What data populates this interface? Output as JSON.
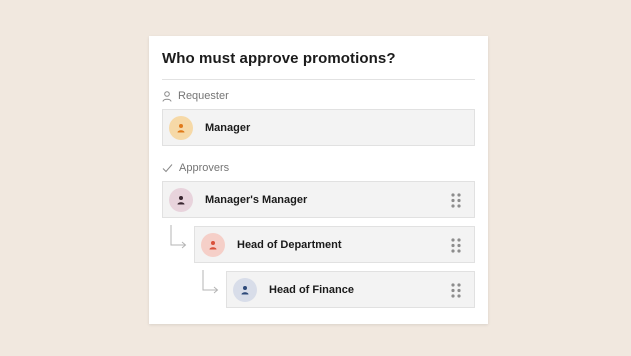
{
  "card": {
    "title": "Who must approve promotions?"
  },
  "requester": {
    "section_label": "Requester",
    "section_icon": "person-outline-icon",
    "name": "Manager",
    "avatar_color": "#f6d9a7",
    "avatar_icon_color": "#e07a1a"
  },
  "approvers": {
    "section_label": "Approvers",
    "section_icon": "checkmark-icon",
    "items": [
      {
        "label": "Manager's Manager",
        "avatar_color": "#e8d3dc",
        "avatar_icon_color": "#3a2630",
        "handle_icon": "drag-handle-icon"
      },
      {
        "label": "Head of Department",
        "avatar_color": "#f5cfc8",
        "avatar_icon_color": "#d9503a",
        "handle_icon": "drag-handle-icon"
      },
      {
        "label": "Head of Finance",
        "avatar_color": "#d8dde9",
        "avatar_icon_color": "#2e4a7a",
        "handle_icon": "drag-handle-icon"
      }
    ]
  }
}
